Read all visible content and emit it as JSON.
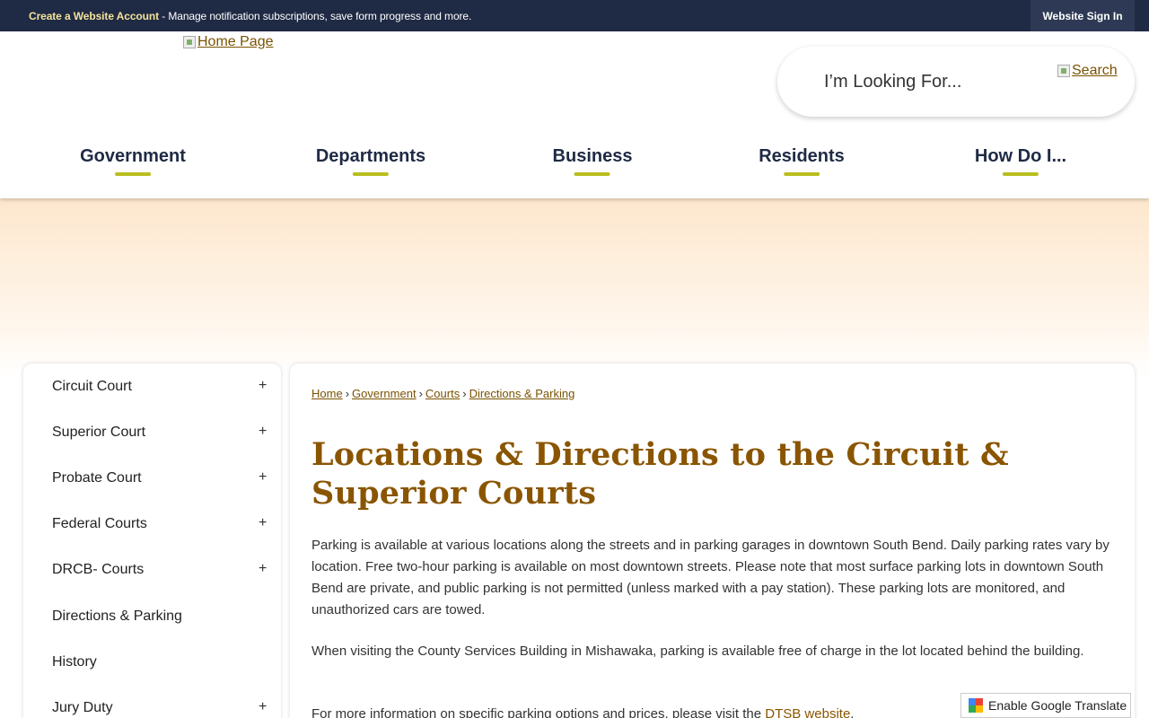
{
  "topbar": {
    "account_link": "Create a Website Account",
    "account_desc": " - Manage notification subscriptions, save form progress and more.",
    "signin_label": "Website Sign In"
  },
  "header": {
    "logo_alt": "Home Page",
    "search_placeholder": "I’m Looking For...",
    "search_button_alt": "Search"
  },
  "nav": [
    {
      "label": "Government"
    },
    {
      "label": "Departments"
    },
    {
      "label": "Business"
    },
    {
      "label": "Residents"
    },
    {
      "label": "How Do I..."
    }
  ],
  "sidebar": {
    "items": [
      {
        "label": "Circuit Court",
        "expandable": "+"
      },
      {
        "label": "Superior Court",
        "expandable": "+"
      },
      {
        "label": "Probate Court",
        "expandable": "+"
      },
      {
        "label": "Federal Courts",
        "expandable": "+"
      },
      {
        "label": "DRCB- Courts",
        "expandable": "+"
      },
      {
        "label": "Directions & Parking",
        "expandable": ""
      },
      {
        "label": "History",
        "expandable": ""
      },
      {
        "label": "Jury Duty",
        "expandable": "+"
      }
    ]
  },
  "breadcrumb": [
    {
      "label": "Home"
    },
    {
      "label": "Government"
    },
    {
      "label": "Courts"
    },
    {
      "label": "Directions & Parking"
    }
  ],
  "breadcrumb_sep": "›",
  "main": {
    "title": "Locations & Directions to the Circuit & Superior Courts",
    "para1": "Parking is available at various locations along the streets and in parking garages in downtown South Bend. Daily parking rates vary by location. Free two-hour parking is available on most downtown streets. Please note that most surface parking lots in downtown South Bend are private, and public parking is not permitted (unless marked with a pay station). These parking lots are monitored, and unauthorized cars are towed.",
    "para2": "When visiting the County Services Building in Mishawaka, parking is available free of charge in the lot located behind the building.",
    "para3_text": "For more information on specific parking options and prices, please visit the ",
    "para3_link": "DTSB website",
    "para3_end": "."
  },
  "translate": {
    "label": "Enable Google Translate"
  },
  "colors": {
    "topbar_bg": "#1f2a44",
    "accent_link": "#7a5200",
    "title_color": "#8a5500",
    "nav_underline": "#b9be1e"
  }
}
